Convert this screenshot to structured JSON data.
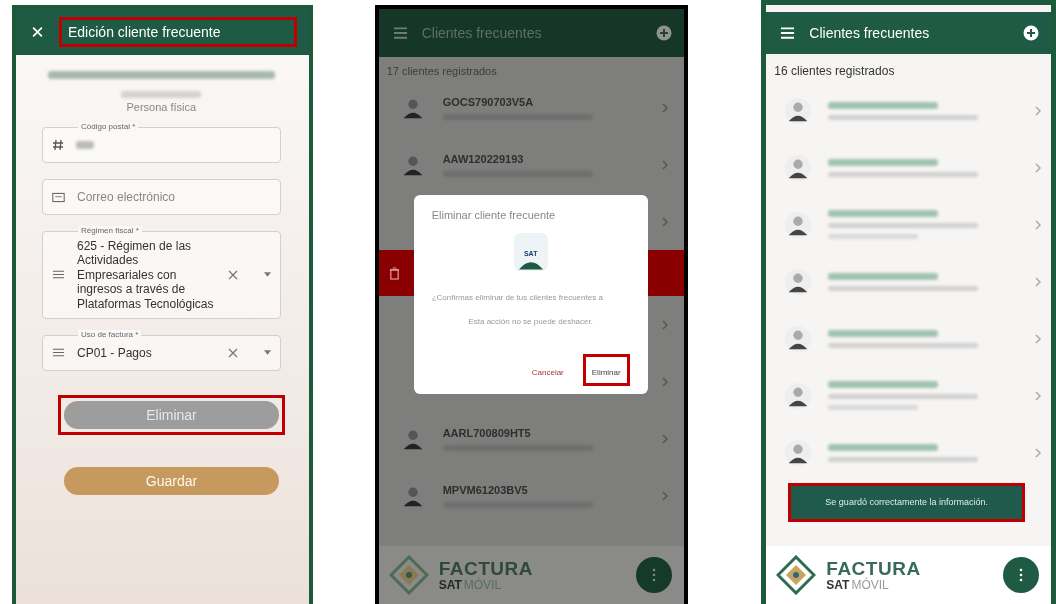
{
  "edit_screen": {
    "title": "Edición cliente frecuente",
    "title_highlighted": true,
    "person_type": "Persona física",
    "fields": [
      {
        "kind": "number",
        "label": "Código postal *"
      },
      {
        "kind": "email",
        "placeholder": "Correo electrónico"
      },
      {
        "kind": "select",
        "label": "Régimen fiscal *",
        "value": "625 - Régimen de las Actividades Empresariales con ingresos a través de Plataformas Tecnológicas"
      },
      {
        "kind": "select",
        "label": "Uso de factura *",
        "value": "CP01 - Pagos"
      }
    ],
    "buttons": [
      {
        "label": "Eliminar",
        "disabled": true,
        "highlighted": true
      },
      {
        "label": "Guardar",
        "disabled": false,
        "highlighted": false
      }
    ]
  },
  "delete_screen": {
    "title": "Clientes frecuentes",
    "count": "17 clientes registrados",
    "clients": [
      {
        "kind": "client",
        "rfc": "GOCS790703V5A"
      },
      {
        "kind": "client",
        "rfc": "AAW120229193"
      },
      {
        "kind": "covered"
      },
      {
        "kind": "swiped"
      },
      {
        "kind": "covered"
      },
      {
        "kind": "covered"
      },
      {
        "kind": "client",
        "rfc": "AARL700809HT5"
      },
      {
        "kind": "client",
        "rfc": "MPVM61203BV5"
      }
    ],
    "dialog": {
      "title": "Eliminar cliente frecuente",
      "app_icon_label": "SAT",
      "message": "¿Confirmas eliminar de tus clientes frecuentes a",
      "note": "Esta acción no se puede deshacer.",
      "buttons": [
        {
          "label": "Cancelar",
          "highlighted": false
        },
        {
          "label": "Eliminar",
          "highlighted": true
        }
      ]
    },
    "footer": {
      "brand": "FACTURA",
      "brand_sub_bold": "SAT",
      "brand_sub": "MÓVIL"
    }
  },
  "saved_screen": {
    "title": "Clientes frecuentes",
    "count": "16 clientes registrados",
    "clients": [
      {
        "kind": "two_line"
      },
      {
        "kind": "two_line"
      },
      {
        "kind": "three_line"
      },
      {
        "kind": "two_line"
      },
      {
        "kind": "two_line"
      },
      {
        "kind": "three_line"
      },
      {
        "kind": "two_line"
      }
    ],
    "snackbar": {
      "message": "Se guardó correctamente la información.",
      "highlighted": true
    },
    "footer": {
      "brand": "FACTURA",
      "brand_sub_bold": "SAT",
      "brand_sub": "MÓVIL"
    }
  }
}
